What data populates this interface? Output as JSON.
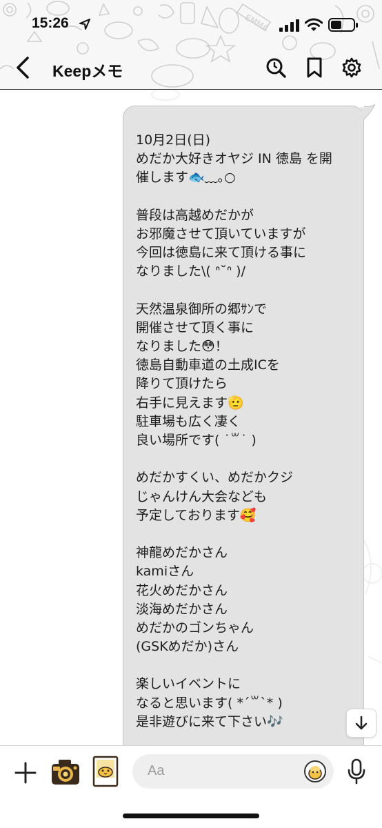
{
  "status_bar": {
    "time": "15:26",
    "icons": [
      "location-arrow-icon",
      "signal-icon",
      "wifi-icon",
      "battery-icon"
    ]
  },
  "header": {
    "title": "Keepメモ",
    "back_icon": "chevron-left-icon",
    "actions": [
      "search-icon",
      "bookmark-icon",
      "gear-icon"
    ]
  },
  "message": {
    "lines": [
      "10月2日(日)",
      "めだか大好きオヤジ IN 徳島 を開",
      "催します🐟﹏｡○",
      "",
      "普段は高越めだかが",
      "お邪魔させて頂いていますが",
      "今回は徳島に来て頂ける事に",
      "なりました\\( ᐢ˘ᐢ )/",
      "",
      "天然温泉御所の郷ｻﾝで",
      "開催させて頂く事に",
      "なりました😳！",
      "徳島自動車道の土成ICを",
      "降りて頂けたら",
      "右手に見えます🫡",
      "駐車場も広く凄く",
      "良い場所です( ˙꒳˙ )",
      "",
      "めだかすくい、めだかクジ",
      "じゃんけん大会なども",
      "予定しております🥰",
      "",
      "神龍めだかさん",
      "kamiさん",
      "花火めだかさん",
      "淡海めだかさん",
      "めだかのゴンちゃん",
      "(GSKめだか)さん",
      "",
      "楽しいイベントに",
      "なると思います( *´꒳`* )",
      "是非遊びに来て下さい🎶"
    ]
  },
  "input_bar": {
    "placeholder": "Aa",
    "icons": [
      "plus-icon",
      "camera-icon",
      "photo-icon",
      "sticker-icon",
      "microphone-icon"
    ]
  },
  "scroll_down_icon": "arrow-down-icon",
  "colors": {
    "bubble_bg": "#e3e3e3",
    "header_bg": "#f7f7f7",
    "input_bg": "#efefef",
    "text": "#1d1d1d"
  }
}
